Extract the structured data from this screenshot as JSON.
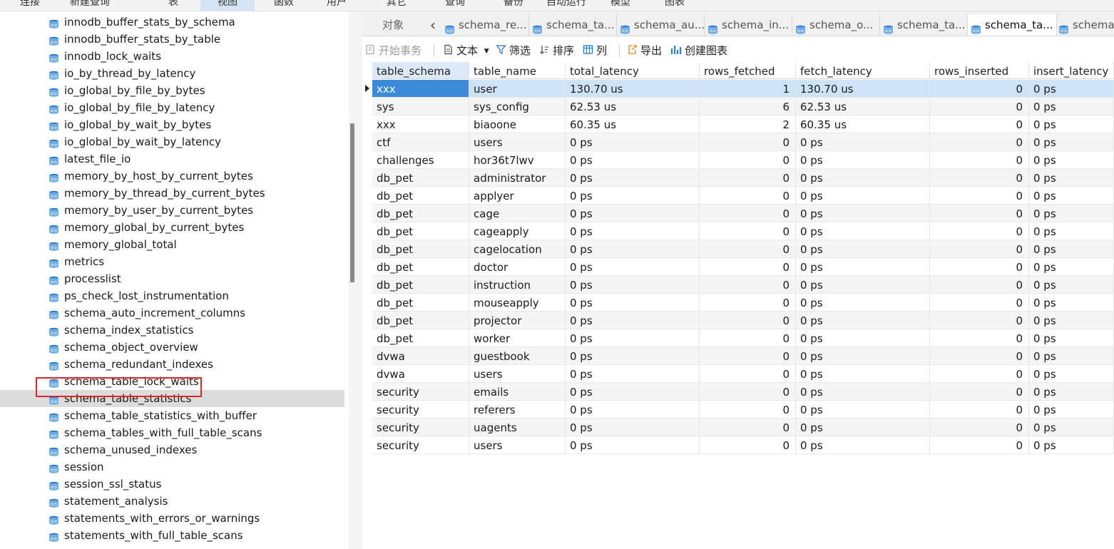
{
  "menu": [
    "连接",
    "新建查询",
    "表",
    "视图",
    "函数",
    "用户",
    "其它",
    "查询",
    "备份",
    "自动运行",
    "模型",
    "图表"
  ],
  "menu_active_index": 3,
  "tree": {
    "items": [
      "innodb_buffer_stats_by_schema",
      "innodb_buffer_stats_by_table",
      "innodb_lock_waits",
      "io_by_thread_by_latency",
      "io_global_by_file_by_bytes",
      "io_global_by_file_by_latency",
      "io_global_by_wait_by_bytes",
      "io_global_by_wait_by_latency",
      "latest_file_io",
      "memory_by_host_by_current_bytes",
      "memory_by_thread_by_current_bytes",
      "memory_by_user_by_current_bytes",
      "memory_global_by_current_bytes",
      "memory_global_total",
      "metrics",
      "processlist",
      "ps_check_lost_instrumentation",
      "schema_auto_increment_columns",
      "schema_index_statistics",
      "schema_object_overview",
      "schema_redundant_indexes",
      "schema_table_lock_waits",
      "schema_table_statistics",
      "schema_table_statistics_with_buffer",
      "schema_tables_with_full_table_scans",
      "schema_unused_indexes",
      "session",
      "session_ssl_status",
      "statement_analysis",
      "statements_with_errors_or_warnings",
      "statements_with_full_table_scans"
    ],
    "selected_index": 22,
    "item_icon": "view-icon"
  },
  "tabs": {
    "object_tab": "对象",
    "docs": [
      "schema_re...",
      "schema_ta...",
      "schema_au...",
      "schema_in...",
      "schema_o...",
      "schema_ta...",
      "schema_ta...",
      "schema"
    ],
    "active_index": 6
  },
  "toolbar": {
    "begin_transaction": "开始事务",
    "text": "文本",
    "filter": "筛选",
    "sort": "排序",
    "columns": "列",
    "export": "导出",
    "create_chart": "创建图表"
  },
  "grid": {
    "columns": [
      "table_schema",
      "table_name",
      "total_latency",
      "rows_fetched",
      "fetch_latency",
      "rows_inserted",
      "insert_latency"
    ],
    "numeric_columns": [
      3,
      5
    ],
    "rows": [
      [
        "xxx",
        "user",
        "130.70 us",
        "1",
        "130.70 us",
        "0",
        "0 ps"
      ],
      [
        "sys",
        "sys_config",
        "62.53 us",
        "6",
        "62.53 us",
        "0",
        "0 ps"
      ],
      [
        "xxx",
        "biaoone",
        "60.35 us",
        "2",
        "60.35 us",
        "0",
        "0 ps"
      ],
      [
        "ctf",
        "users",
        "0 ps",
        "0",
        "0 ps",
        "0",
        "0 ps"
      ],
      [
        "challenges",
        "hor36t7lwv",
        "0 ps",
        "0",
        "0 ps",
        "0",
        "0 ps"
      ],
      [
        "db_pet",
        "administrator",
        "0 ps",
        "0",
        "0 ps",
        "0",
        "0 ps"
      ],
      [
        "db_pet",
        "applyer",
        "0 ps",
        "0",
        "0 ps",
        "0",
        "0 ps"
      ],
      [
        "db_pet",
        "cage",
        "0 ps",
        "0",
        "0 ps",
        "0",
        "0 ps"
      ],
      [
        "db_pet",
        "cageapply",
        "0 ps",
        "0",
        "0 ps",
        "0",
        "0 ps"
      ],
      [
        "db_pet",
        "cagelocation",
        "0 ps",
        "0",
        "0 ps",
        "0",
        "0 ps"
      ],
      [
        "db_pet",
        "doctor",
        "0 ps",
        "0",
        "0 ps",
        "0",
        "0 ps"
      ],
      [
        "db_pet",
        "instruction",
        "0 ps",
        "0",
        "0 ps",
        "0",
        "0 ps"
      ],
      [
        "db_pet",
        "mouseapply",
        "0 ps",
        "0",
        "0 ps",
        "0",
        "0 ps"
      ],
      [
        "db_pet",
        "projector",
        "0 ps",
        "0",
        "0 ps",
        "0",
        "0 ps"
      ],
      [
        "db_pet",
        "worker",
        "0 ps",
        "0",
        "0 ps",
        "0",
        "0 ps"
      ],
      [
        "dvwa",
        "guestbook",
        "0 ps",
        "0",
        "0 ps",
        "0",
        "0 ps"
      ],
      [
        "dvwa",
        "users",
        "0 ps",
        "0",
        "0 ps",
        "0",
        "0 ps"
      ],
      [
        "security",
        "emails",
        "0 ps",
        "0",
        "0 ps",
        "0",
        "0 ps"
      ],
      [
        "security",
        "referers",
        "0 ps",
        "0",
        "0 ps",
        "0",
        "0 ps"
      ],
      [
        "security",
        "uagents",
        "0 ps",
        "0",
        "0 ps",
        "0",
        "0 ps"
      ],
      [
        "security",
        "users",
        "0 ps",
        "0",
        "0 ps",
        "0",
        "0 ps"
      ]
    ],
    "selected_row": 0
  },
  "colors": {
    "selection_blue": "#3d8bd8",
    "row_highlight": "#cfe3f7",
    "tree_selection_outline": "#e0262a",
    "icon_blue": "#2f7fd0"
  }
}
